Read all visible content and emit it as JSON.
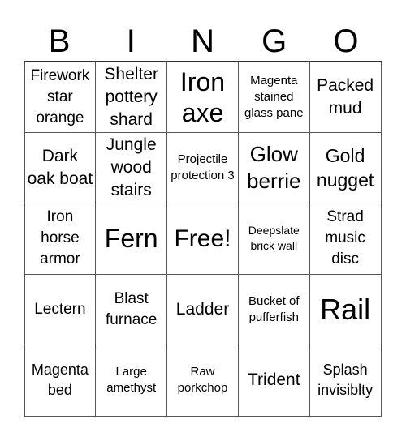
{
  "header": [
    "B",
    "I",
    "N",
    "G",
    "O"
  ],
  "cells": [
    [
      "Firework star orange",
      "Shelter pottery shard",
      "Iron axe",
      "Magenta stained glass pane",
      "Packed mud"
    ],
    [
      "Dark oak boat",
      "Jungle wood stairs",
      "Projectile protection 3",
      "Glow berrie",
      "Gold nugget"
    ],
    [
      "Iron horse armor",
      "Fern",
      "Free!",
      "Deepslate brick wall",
      "Strad music disc"
    ],
    [
      "Lectern",
      "Blast furnace",
      "Ladder",
      "Bucket of pufferfish",
      "Rail"
    ],
    [
      "Magenta bed",
      "Large amethyst",
      "Raw porkchop",
      "Trident",
      "Splash invisiblty"
    ]
  ]
}
